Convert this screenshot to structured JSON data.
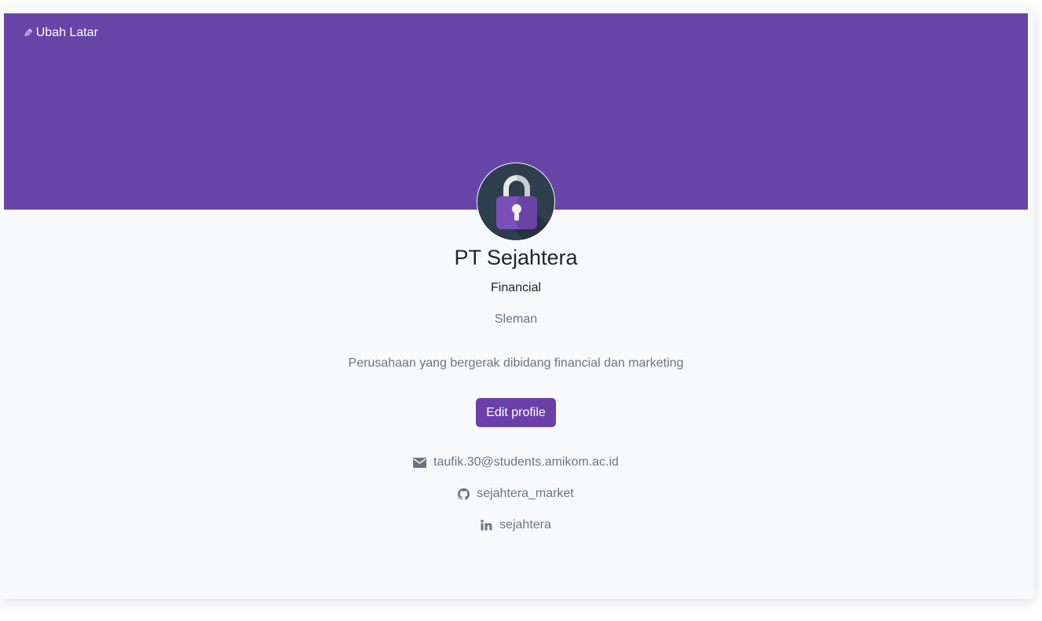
{
  "banner": {
    "change_bg_label": "Ubah Latar",
    "color": "#6645a6"
  },
  "profile": {
    "avatar_icon": "padlock-icon",
    "name": "PT Sejahtera",
    "category": "Financial",
    "location": "Sleman",
    "description": "Perusahaan yang bergerak dibidang financial dan marketing",
    "edit_button_label": "Edit profile"
  },
  "contacts": {
    "email": {
      "icon": "envelope-icon",
      "value": "taufik.30@students.amikom.ac.id"
    },
    "github": {
      "icon": "github-icon",
      "value": "sejahtera_market"
    },
    "linkedin": {
      "icon": "linkedin-icon",
      "value": "sejahtera"
    }
  },
  "colors": {
    "accent": "#6a40a8",
    "page_bg": "#f8f9fa",
    "muted_text": "#6c757d",
    "heading_text": "#212529"
  }
}
